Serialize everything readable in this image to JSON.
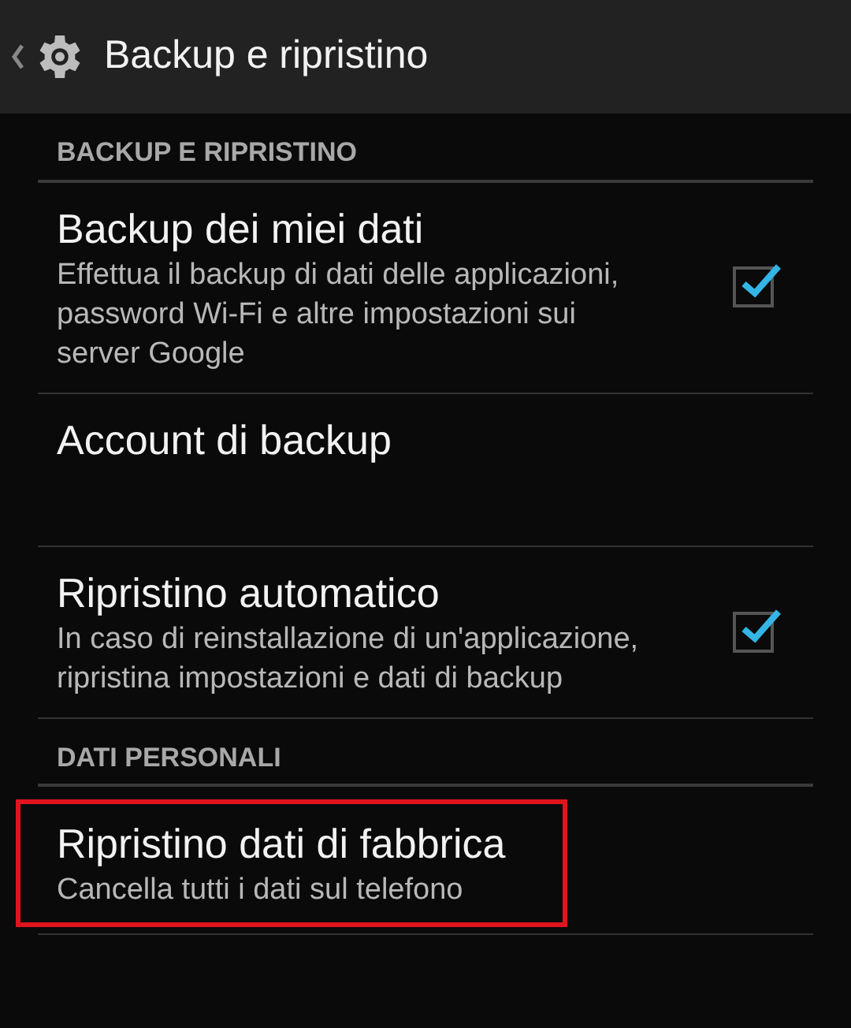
{
  "action_bar": {
    "title": "Backup e ripristino"
  },
  "sections": [
    {
      "title": "BACKUP E RIPRISTINO",
      "items": [
        {
          "kind": "checkbox",
          "title": "Backup dei miei dati",
          "summary": "Effettua il backup di dati delle applicazioni, password Wi-Fi e altre impostazioni sui server Google",
          "checked": true,
          "highlighted": false
        },
        {
          "kind": "plain",
          "title": "Account di backup",
          "highlighted": false
        },
        {
          "kind": "checkbox",
          "title": "Ripristino automatico",
          "summary": "In caso di reinstallazione di un'applicazione, ripristina impostazioni e dati di backup",
          "checked": true,
          "highlighted": false
        }
      ]
    },
    {
      "title": "DATI PERSONALI",
      "items": [
        {
          "kind": "plain",
          "title": "Ripristino dati di fabbrica",
          "summary": "Cancella tutti i dati sul telefono",
          "highlighted": true
        }
      ]
    }
  ]
}
